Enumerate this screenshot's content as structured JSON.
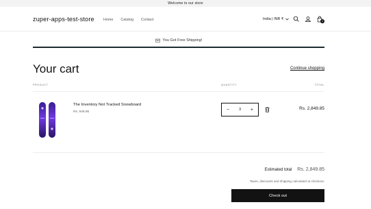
{
  "announcement": "Welcome to our store",
  "header": {
    "logo": "zuper-apps-test-store",
    "nav": [
      "Home",
      "Catalog",
      "Contact"
    ],
    "locale": "India | INR ₹",
    "cart_count": "1"
  },
  "shipping": {
    "message": "You Got Free Shipping!",
    "progress": 1.0
  },
  "cart": {
    "title": "Your cart",
    "continue_label": "Continue shopping",
    "columns": {
      "product": "PRODUCT",
      "quantity": "QUANTITY",
      "total": "TOTAL"
    },
    "items": [
      {
        "name": "The Inventory Not Tracked Snowboard",
        "price": "Rs. 949.95",
        "quantity": "3",
        "line_total": "Rs. 2,849.85"
      }
    ],
    "estimated_label": "Estimated total",
    "estimated_value": "Rs. 2,849.85",
    "taxes_note": "Taxes, discounts and shipping calculated at checkout.",
    "checkout_label": "Check out"
  },
  "colors": {
    "text": "#121212",
    "accent_dark": "#1d2b2e",
    "snowboard": "#5b2bbf"
  },
  "icons": {
    "search": "search-icon",
    "account": "user-icon",
    "cart": "bag-icon",
    "shipping": "shipping-box-icon",
    "delete": "trash-icon",
    "dropdown": "chevron-down-icon"
  }
}
